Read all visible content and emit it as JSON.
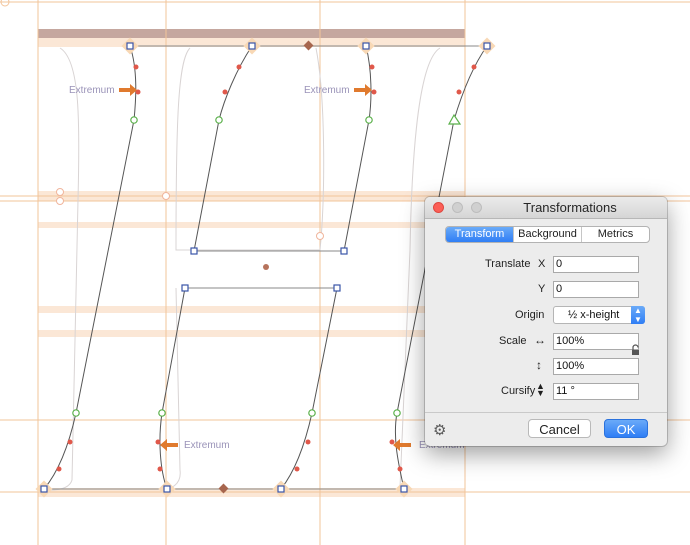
{
  "annotations": {
    "extremum_1": "Extremum",
    "extremum_2": "Extremum",
    "extremum_3": "Extremum",
    "extremum_4": "Extremum"
  },
  "colors": {
    "guide": "#f2c49a",
    "zone": "#fbe7d6",
    "zone_dark": "#c5a79f",
    "outline": "#555555",
    "node_square": "#3a55a8",
    "node_smooth": "#5bb14b",
    "handle": "#e0584a",
    "arrow": "#e07a2e",
    "accent_blue": "#2f7ef5"
  },
  "dialog": {
    "title": "Transformations",
    "tabs": [
      {
        "label": "Transform",
        "active": true
      },
      {
        "label": "Background",
        "active": false
      },
      {
        "label": "Metrics",
        "active": false
      }
    ],
    "translate_label": "Translate",
    "x_label": "X",
    "x_value": "0",
    "y_label": "Y",
    "y_value": "0",
    "origin_label": "Origin",
    "origin_value": "½ x-height",
    "scale_label": "Scale",
    "scale_h_icon": "↔",
    "scale_h_value": "100%",
    "scale_v_icon": "↕",
    "scale_v_value": "100%",
    "cursify_label": "Cursify",
    "cursify_value": "11 °",
    "cancel_label": "Cancel",
    "ok_label": "OK",
    "gear_icon": "⚙"
  }
}
